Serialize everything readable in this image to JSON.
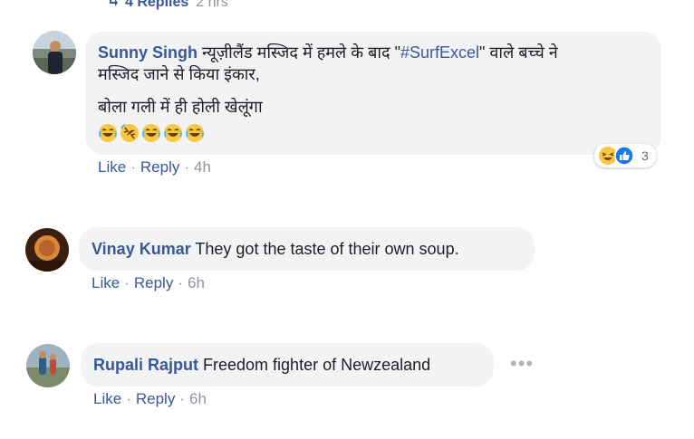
{
  "replies_link": {
    "label": "4 Replies",
    "time": "2 hrs"
  },
  "comments": [
    {
      "author": "Sunny Singh",
      "text_line1": "न्यूज़ीलैंड मस्जिद में हमले के बाद \"",
      "hashtag": "#SurfExcel",
      "text_line1_end": "\" वाले बच्चे ने",
      "text_line2": "मस्जिद जाने से किया इंकार,",
      "text_line3": "बोला गली में ही होली खेलूंगा",
      "emojis": [
        "laughing-crying",
        "rolling-laughing",
        "laughing-crying",
        "laughing-crying",
        "laughing-crying"
      ],
      "reaction_count": "3",
      "actions": {
        "like": "Like",
        "reply": "Reply",
        "time": "4h"
      }
    },
    {
      "author": "Vinay Kumar",
      "text": "They got the taste of their own soup.",
      "actions": {
        "like": "Like",
        "reply": "Reply",
        "time": "6h"
      }
    },
    {
      "author": "Rupali Rajput",
      "text": "Freedom fighter of Newzealand",
      "more": "•••",
      "actions": {
        "like": "Like",
        "reply": "Reply",
        "time": "6h"
      }
    }
  ],
  "colors": {
    "link": "#385898",
    "bubble": "#f2f3f5",
    "meta": "#90949c",
    "like_blue": "#1877f2",
    "emoji_yellow": "#f7c844"
  }
}
